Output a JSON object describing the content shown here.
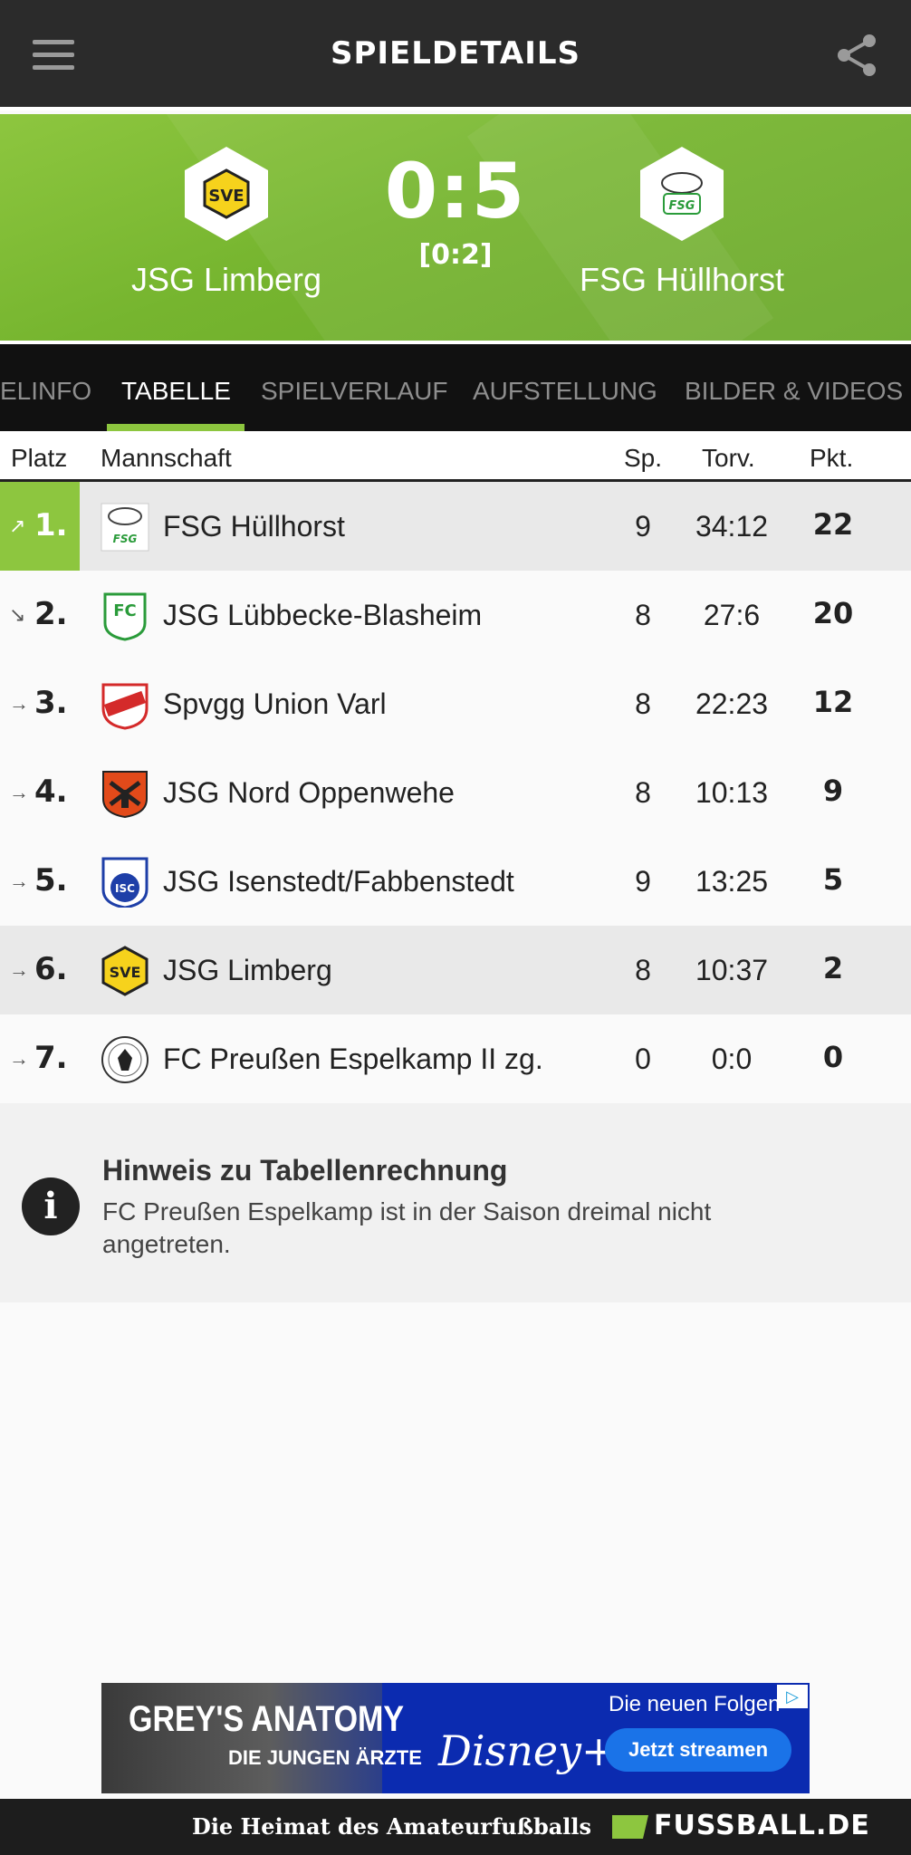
{
  "header": {
    "title": "SPIELDETAILS",
    "menu_icon": "hamburger-menu-icon",
    "share_icon": "share-icon"
  },
  "match": {
    "home": {
      "name": "JSG Limberg"
    },
    "away": {
      "name": "FSG Hüllhorst"
    },
    "score": "0:5",
    "halftime": "[0:2]"
  },
  "tabs": [
    "ELINFO",
    "TABELLE",
    "SPIELVERLAUF",
    "AUFSTELLUNG",
    "BILDER & VIDEOS"
  ],
  "active_tab": "TABELLE",
  "table": {
    "headers": {
      "platz": "Platz",
      "mannschaft": "Mannschaft",
      "sp": "Sp.",
      "torv": "Torv.",
      "pkt": "Pkt."
    },
    "rows": [
      {
        "rank": "1.",
        "trend": "↗",
        "team": "FSG Hüllhorst",
        "sp": "9",
        "torv": "34:12",
        "pkt": "22"
      },
      {
        "rank": "2.",
        "trend": "↘",
        "team": "JSG Lübbecke-Blasheim",
        "sp": "8",
        "torv": "27:6",
        "pkt": "20"
      },
      {
        "rank": "3.",
        "trend": "→",
        "team": "Spvgg Union Varl",
        "sp": "8",
        "torv": "22:23",
        "pkt": "12"
      },
      {
        "rank": "4.",
        "trend": "→",
        "team": "JSG Nord Oppenwehe",
        "sp": "8",
        "torv": "10:13",
        "pkt": "9"
      },
      {
        "rank": "5.",
        "trend": "→",
        "team": "JSG Isenstedt/Fabbenstedt",
        "sp": "9",
        "torv": "13:25",
        "pkt": "5"
      },
      {
        "rank": "6.",
        "trend": "→",
        "team": "JSG Limberg",
        "sp": "8",
        "torv": "10:37",
        "pkt": "2"
      },
      {
        "rank": "7.",
        "trend": "→",
        "team": "FC Preußen Espelkamp II zg.",
        "sp": "0",
        "torv": "0:0",
        "pkt": "0"
      }
    ]
  },
  "notice": {
    "title": "Hinweis zu Tabellenrechnung",
    "text": "FC Preußen Espelkamp ist in der Saison dreimal nicht angetreten."
  },
  "ad": {
    "show": "GREY'S ANATOMY",
    "show_sub": "DIE JUNGEN ÄRZTE",
    "brand": "Disney+",
    "promo": "Die neuen Folgen",
    "cta": "Jetzt streamen"
  },
  "footer": {
    "tagline": "Die Heimat des Amateurfußballs",
    "brand": "FUSSBALL.DE"
  },
  "colors": {
    "accent": "#8dc63f",
    "topbar": "#2b2b2b",
    "tabs_bg": "#111111"
  }
}
